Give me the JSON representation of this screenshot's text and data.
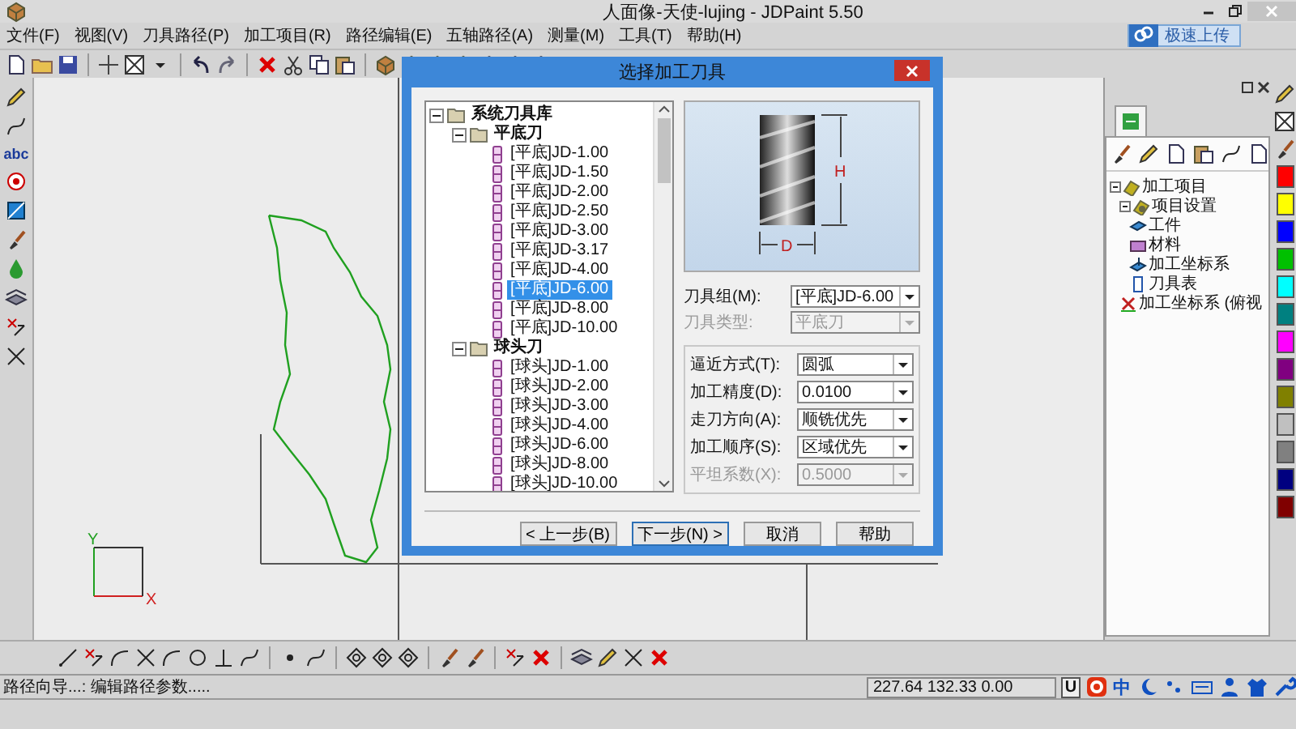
{
  "window": {
    "title": "人面像-天使-lujing - JDPaint 5.50"
  },
  "menu": [
    "文件(F)",
    "视图(V)",
    "刀具路径(P)",
    "加工项目(R)",
    "路径编辑(E)",
    "五轴路径(A)",
    "测量(M)",
    "工具(T)",
    "帮助(H)"
  ],
  "upload_button": {
    "label": "极速上传"
  },
  "left_toolbar": {
    "text_tool": "abc"
  },
  "canvas": {
    "axis_labels": [
      "Y",
      "X"
    ]
  },
  "project_panel": {
    "tree": [
      {
        "label": "加工项目",
        "kind": "project",
        "expanded": true,
        "children": [
          {
            "label": "项目设置",
            "kind": "settings",
            "expanded": true,
            "children": [
              {
                "label": "工件",
                "kind": "workpiece"
              },
              {
                "label": "材料",
                "kind": "material"
              },
              {
                "label": "加工坐标系",
                "kind": "coordinate"
              },
              {
                "label": "刀具表",
                "kind": "tooltable"
              }
            ]
          },
          {
            "label": "加工坐标系 (俯视",
            "kind": "view"
          }
        ]
      }
    ]
  },
  "palette": [
    {
      "color": "#ff0000"
    },
    {
      "color": "#ffff00"
    },
    {
      "color": "#0000ff"
    },
    {
      "color": "#00c000"
    },
    {
      "color": "#00ffff"
    },
    {
      "color": "#008080"
    },
    {
      "color": "#ff00ff"
    },
    {
      "color": "#800080"
    },
    {
      "color": "#808000"
    },
    {
      "color": "#c0c0c0"
    },
    {
      "color": "#808080"
    },
    {
      "color": "#000080"
    },
    {
      "color": "#800000"
    }
  ],
  "dialog": {
    "title": "选择加工刀具",
    "tree": [
      {
        "label": "系统刀具库",
        "expanded": true,
        "children": [
          {
            "label": "平底刀",
            "expanded": true,
            "children": [
              {
                "label": "[平底]JD-1.00",
                "selected": false
              },
              {
                "label": "[平底]JD-1.50",
                "selected": false
              },
              {
                "label": "[平底]JD-2.00",
                "selected": false
              },
              {
                "label": "[平底]JD-2.50",
                "selected": false
              },
              {
                "label": "[平底]JD-3.00",
                "selected": false
              },
              {
                "label": "[平底]JD-3.17",
                "selected": false
              },
              {
                "label": "[平底]JD-4.00",
                "selected": false
              },
              {
                "label": "[平底]JD-6.00",
                "selected": true
              },
              {
                "label": "[平底]JD-8.00",
                "selected": false
              },
              {
                "label": "[平底]JD-10.00",
                "selected": false
              }
            ]
          },
          {
            "label": "球头刀",
            "expanded": true,
            "children": [
              {
                "label": "[球头]JD-1.00",
                "selected": false
              },
              {
                "label": "[球头]JD-2.00",
                "selected": false
              },
              {
                "label": "[球头]JD-3.00",
                "selected": false
              },
              {
                "label": "[球头]JD-4.00",
                "selected": false
              },
              {
                "label": "[球头]JD-6.00",
                "selected": false
              },
              {
                "label": "[球头]JD-8.00",
                "selected": false
              },
              {
                "label": "[球头]JD-10.00",
                "selected": false
              }
            ]
          }
        ]
      }
    ],
    "tool_image": {
      "height_label": "H",
      "diameter_label": "D"
    },
    "fields": [
      {
        "label": "刀具组(M):",
        "value": "[平底]JD-6.00",
        "disabled": false
      },
      {
        "label": "刀具类型:",
        "value": "平底刀",
        "disabled": true
      }
    ],
    "group_fields": [
      {
        "label": "逼近方式(T):",
        "value": "圆弧",
        "disabled": false
      },
      {
        "label": "加工精度(D):",
        "value": "0.0100",
        "disabled": false
      },
      {
        "label": "走刀方向(A):",
        "value": "顺铣优先",
        "disabled": false
      },
      {
        "label": "加工顺序(S):",
        "value": "区域优先",
        "disabled": false
      },
      {
        "label": "平坦系数(X):",
        "value": "0.5000",
        "disabled": true
      }
    ],
    "buttons": [
      "< 上一步(B)",
      "下一步(N) >",
      "取消",
      "帮助"
    ]
  },
  "status_bar": {
    "message": "路径向导...: 编辑路径参数.....",
    "coordinates": "227.64 132.33 0.00",
    "mode": "U",
    "ime": "中"
  }
}
